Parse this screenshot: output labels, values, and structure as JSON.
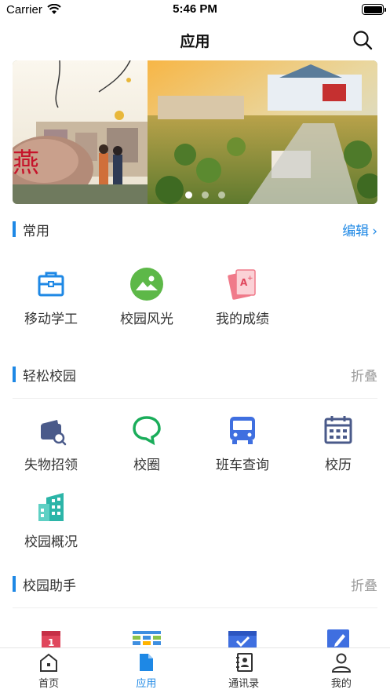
{
  "status": {
    "carrier": "Carrier",
    "time": "5:46 PM"
  },
  "nav": {
    "title": "应用"
  },
  "banner": {
    "caption_char": "燕"
  },
  "sections": {
    "common": {
      "title": "常用",
      "action": "编辑"
    },
    "easy": {
      "title": "轻松校园",
      "action": "折叠"
    },
    "assistant": {
      "title": "校园助手",
      "action": "折叠"
    }
  },
  "apps": {
    "common": [
      {
        "label": "移动学工",
        "icon": "briefcase-icon"
      },
      {
        "label": "校园风光",
        "icon": "landscape-icon"
      },
      {
        "label": "我的成绩",
        "icon": "grade-card-icon"
      }
    ],
    "easy": [
      {
        "label": "失物招领",
        "icon": "wallet-search-icon"
      },
      {
        "label": "校圈",
        "icon": "chat-bubble-icon"
      },
      {
        "label": "班车查询",
        "icon": "bus-icon"
      },
      {
        "label": "校历",
        "icon": "calendar-icon"
      },
      {
        "label": "校园概况",
        "icon": "building-icon"
      }
    ]
  },
  "tabs": [
    {
      "label": "首页",
      "icon": "home-icon"
    },
    {
      "label": "应用",
      "icon": "app-doc-icon",
      "active": true
    },
    {
      "label": "通讯录",
      "icon": "contacts-icon"
    },
    {
      "label": "我的",
      "icon": "user-icon"
    }
  ],
  "colors": {
    "accent": "#1e88e5",
    "muted": "#9b9b9b"
  }
}
